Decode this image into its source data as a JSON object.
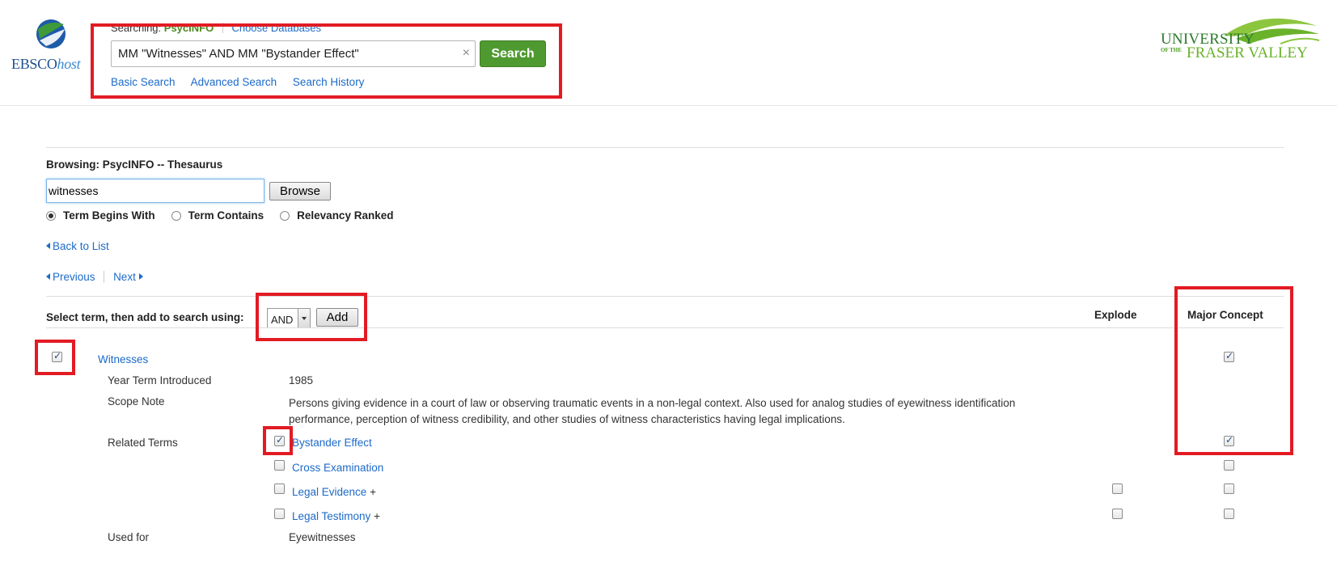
{
  "header": {
    "ebsco_logo": {
      "brand": "EBSCO",
      "suffix": "host"
    },
    "searching_label": "Searching:",
    "searching_db": "PsycINFO",
    "choose_databases": "Choose Databases",
    "search_query": "MM \"Witnesses\" AND MM \"Bystander Effect\"",
    "clear_icon": "close-icon",
    "search_button": "Search",
    "links": [
      "Basic Search",
      "Advanced Search",
      "Search History"
    ],
    "ufv_logo": {
      "line1": "UNIVERSITY",
      "line2_small": "OF THE",
      "line2": "FRASER VALLEY"
    }
  },
  "thesaurus": {
    "title": "Browsing: PsycINFO -- Thesaurus",
    "browse_value": "witnesses",
    "browse_button": "Browse",
    "radio_options": [
      {
        "label": "Term Begins With",
        "selected": true
      },
      {
        "label": "Term Contains",
        "selected": false
      },
      {
        "label": "Relevancy Ranked",
        "selected": false
      }
    ],
    "back_to_list": "Back to List",
    "previous": "Previous",
    "next": "Next",
    "select_label": "Select term, then add to search using:",
    "operator": "AND",
    "add_button": "Add",
    "col_explode": "Explode",
    "col_major": "Major Concept"
  },
  "term": {
    "name": "Witnesses",
    "checked": true,
    "major_checked": true,
    "year_label": "Year Term Introduced",
    "year_value": "1985",
    "scope_label": "Scope Note",
    "scope_line1": "Persons giving evidence in a court of law or observing traumatic events in a non-legal context. Also used for analog studies of eyewitness identification",
    "scope_line2": "performance, perception of witness credibility, and other studies of witness characteristics having legal implications.",
    "related_label": "Related Terms",
    "related": [
      {
        "name": "Bystander Effect",
        "plus": "",
        "checked": true,
        "explode": null,
        "major": true
      },
      {
        "name": "Cross Examination",
        "plus": "",
        "checked": false,
        "explode": null,
        "major": false
      },
      {
        "name": "Legal Evidence",
        "plus": "+",
        "checked": false,
        "explode": false,
        "major": false
      },
      {
        "name": "Legal Testimony",
        "plus": "+",
        "checked": false,
        "explode": false,
        "major": false
      }
    ],
    "used_for_label": "Used for",
    "used_for_value": "Eyewitnesses"
  },
  "highlight_color": "#e21b23",
  "colors": {
    "link": "#1c6ac9",
    "search_button": "#4f9a30"
  }
}
